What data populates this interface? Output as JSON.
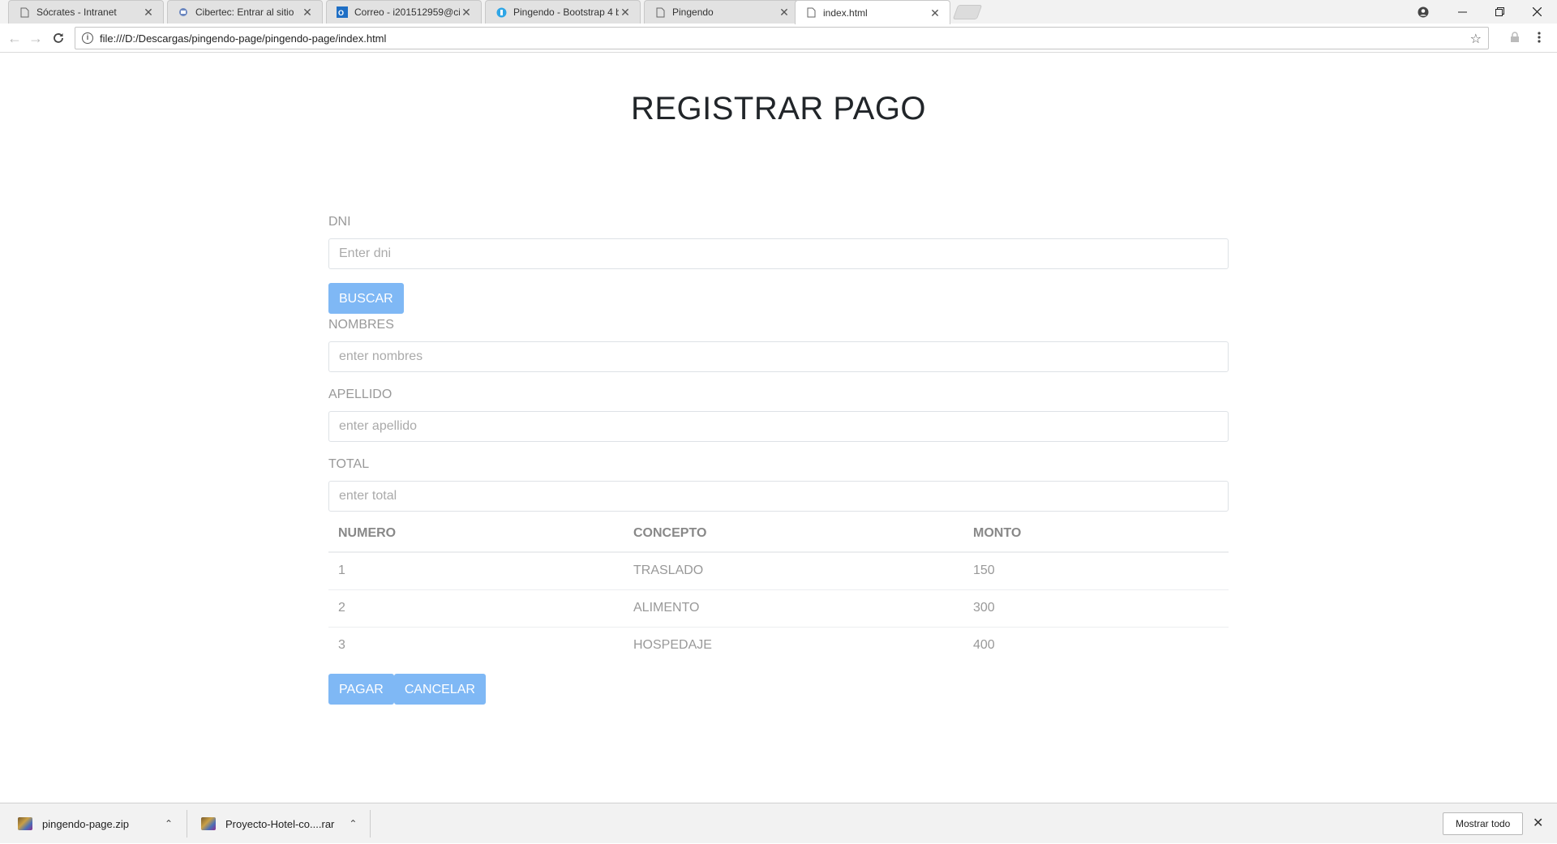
{
  "browser": {
    "tabs": [
      {
        "title": "Sócrates - Intranet",
        "icon": "page-icon"
      },
      {
        "title": "Cibertec: Entrar al sitio",
        "icon": "moodle-icon"
      },
      {
        "title": "Correo - i201512959@ci",
        "icon": "outlook-icon"
      },
      {
        "title": "Pingendo - Bootstrap 4 b",
        "icon": "pingendo-icon"
      },
      {
        "title": "Pingendo",
        "icon": "page-icon"
      },
      {
        "title": "index.html",
        "icon": "page-icon"
      }
    ],
    "active_tab": 5,
    "url": "file:///D:/Descargas/pingendo-page/pingendo-page/index.html"
  },
  "page": {
    "title": "REGISTRAR PAGO",
    "dni": {
      "label": "DNI",
      "placeholder": "Enter dni"
    },
    "search_button": "BUSCAR",
    "nombres": {
      "label": "NOMBRES",
      "placeholder": "enter nombres"
    },
    "apellido": {
      "label": "APELLIDO",
      "placeholder": "enter apellido"
    },
    "total": {
      "label": "TOTAL",
      "placeholder": "enter total"
    },
    "table": {
      "headers": [
        "NUMERO",
        "CONCEPTO",
        "MONTO"
      ],
      "rows": [
        [
          "1",
          "TRASLADO",
          "150"
        ],
        [
          "2",
          "ALIMENTO",
          "300"
        ],
        [
          "3",
          "HOSPEDAJE",
          "400"
        ]
      ]
    },
    "pay_button": "PAGAR",
    "cancel_button": "CANCELAR"
  },
  "downloads": {
    "items": [
      {
        "name": "pingendo-page.zip"
      },
      {
        "name": "Proyecto-Hotel-co....rar"
      }
    ],
    "show_all": "Mostrar todo"
  },
  "colors": {
    "button": "#7fb8f5",
    "muted_text": "#999999",
    "title_text": "#212529"
  }
}
